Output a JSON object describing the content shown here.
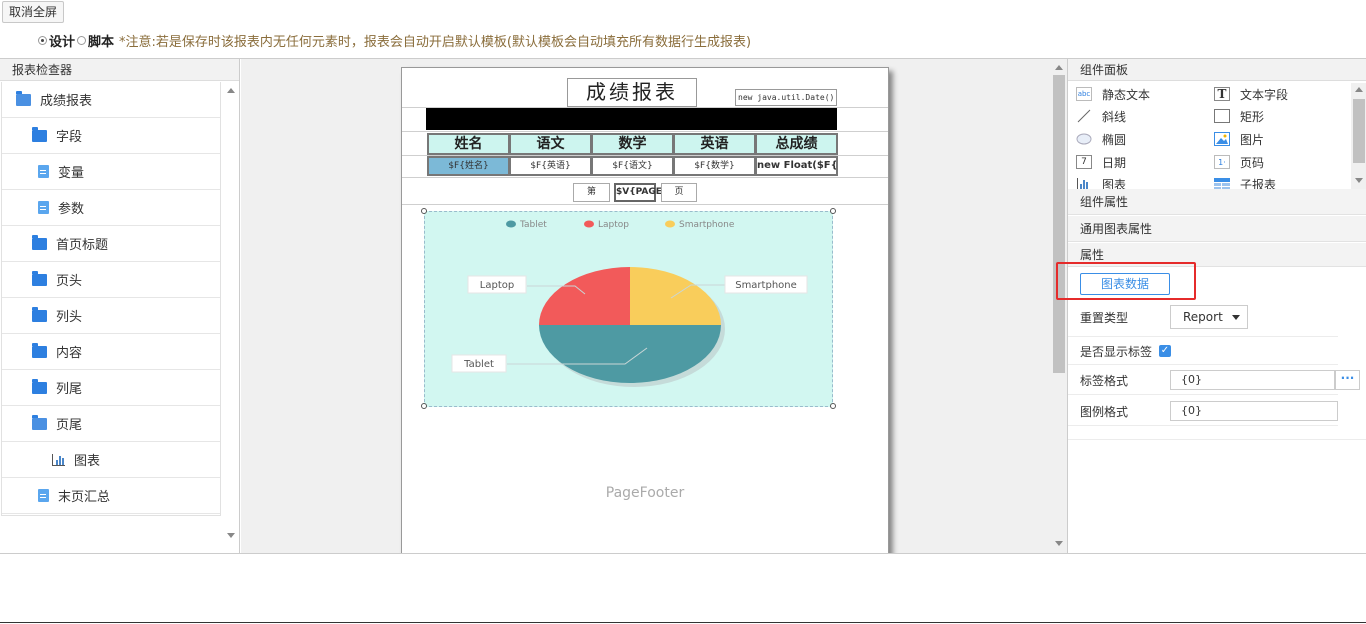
{
  "toolbar": {
    "exit_fullscreen": "取消全屏",
    "mode_design": "设计",
    "mode_script": "脚本",
    "notice": "*注意:若是保存时该报表内无任何元素时，报表会自动开启默认模板(默认模板会自动填充所有数据行生成报表)"
  },
  "inspector": {
    "title": "报表检查器",
    "items": [
      {
        "label": "成绩报表",
        "icon": "folder-open-icon"
      },
      {
        "label": "字段",
        "icon": "folder-icon"
      },
      {
        "label": "变量",
        "icon": "file-icon"
      },
      {
        "label": "参数",
        "icon": "file-icon"
      },
      {
        "label": "首页标题",
        "icon": "folder-icon"
      },
      {
        "label": "页头",
        "icon": "folder-icon"
      },
      {
        "label": "列头",
        "icon": "folder-icon"
      },
      {
        "label": "内容",
        "icon": "folder-icon"
      },
      {
        "label": "列尾",
        "icon": "folder-icon"
      },
      {
        "label": "页尾",
        "icon": "folder-open-icon"
      },
      {
        "label": "图表",
        "icon": "bar-chart-icon"
      },
      {
        "label": "末页汇总",
        "icon": "file-icon"
      }
    ]
  },
  "report": {
    "title": "成绩报表",
    "date_expr": "new java.util.Date()",
    "headers": [
      "姓名",
      "语文",
      "数学",
      "英语",
      "总成绩"
    ],
    "fields": [
      "$F{姓名}",
      "$F{英语}",
      "$F{语文}",
      "$F{数学}",
      "new Float($F{语"
    ],
    "pager": {
      "prefix": "第",
      "expr": "$V{PAGE",
      "suffix": "页"
    },
    "footer": "PageFooter"
  },
  "chart_data": {
    "type": "pie",
    "legend": [
      "Tablet",
      "Laptop",
      "Smartphone"
    ],
    "labels": [
      "Tablet",
      "Laptop",
      "Smartphone"
    ],
    "colors": {
      "Tablet": "#4e9aa3",
      "Laptop": "#f25a5a",
      "Smartphone": "#f9cd5b"
    },
    "values": [
      50,
      25,
      25
    ],
    "legend_position": "top"
  },
  "components": {
    "title": "组件面板",
    "items": [
      {
        "label": "静态文本",
        "icon": "abc-icon"
      },
      {
        "label": "文本字段",
        "icon": "text-field-icon"
      },
      {
        "label": "斜线",
        "icon": "line-icon"
      },
      {
        "label": "矩形",
        "icon": "rectangle-icon"
      },
      {
        "label": "椭圆",
        "icon": "ellipse-icon"
      },
      {
        "label": "图片",
        "icon": "image-icon"
      },
      {
        "label": "日期",
        "icon": "calendar-icon"
      },
      {
        "label": "页码",
        "icon": "page-number-icon"
      },
      {
        "label": "图表",
        "icon": "bar-chart-icon"
      },
      {
        "label": "子报表",
        "icon": "subreport-icon"
      }
    ]
  },
  "properties": {
    "component_props": "组件属性",
    "chart_common": "通用图表属性",
    "props": "属性",
    "chart_data_btn": "图表数据",
    "reset_type_label": "重置类型",
    "reset_type_value": "Report",
    "show_label_label": "是否显示标签",
    "label_format_label": "标签格式",
    "label_format_value": "{0}",
    "legend_format_label": "图例格式",
    "legend_format_value": "{0}",
    "dots": "···"
  }
}
